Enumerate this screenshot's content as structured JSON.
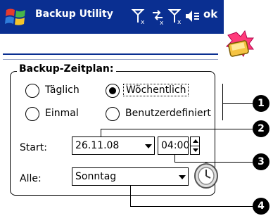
{
  "window": {
    "title": "Backup Utility",
    "ok_label": "ok",
    "status_icons": [
      "signal-off-icon",
      "connectivity-icon",
      "phone-signal-icon",
      "speaker-icon"
    ]
  },
  "group": {
    "title": "Backup-Zeitplan:",
    "radios": [
      {
        "label": "Täglich",
        "selected": false
      },
      {
        "label": "Wöchentlich",
        "selected": true
      },
      {
        "label": "Einmal",
        "selected": false
      },
      {
        "label": "Benutzerdefiniert",
        "selected": false
      }
    ],
    "start_label": "Start:",
    "start_date": "26.11.08",
    "start_time": "04:00",
    "every_label": "Alle:",
    "every_value": "Sonntag"
  },
  "callouts": [
    "1",
    "2",
    "3",
    "4"
  ],
  "colors": {
    "titlebar": "#0a2f91",
    "accent": "#ff3a7a"
  }
}
